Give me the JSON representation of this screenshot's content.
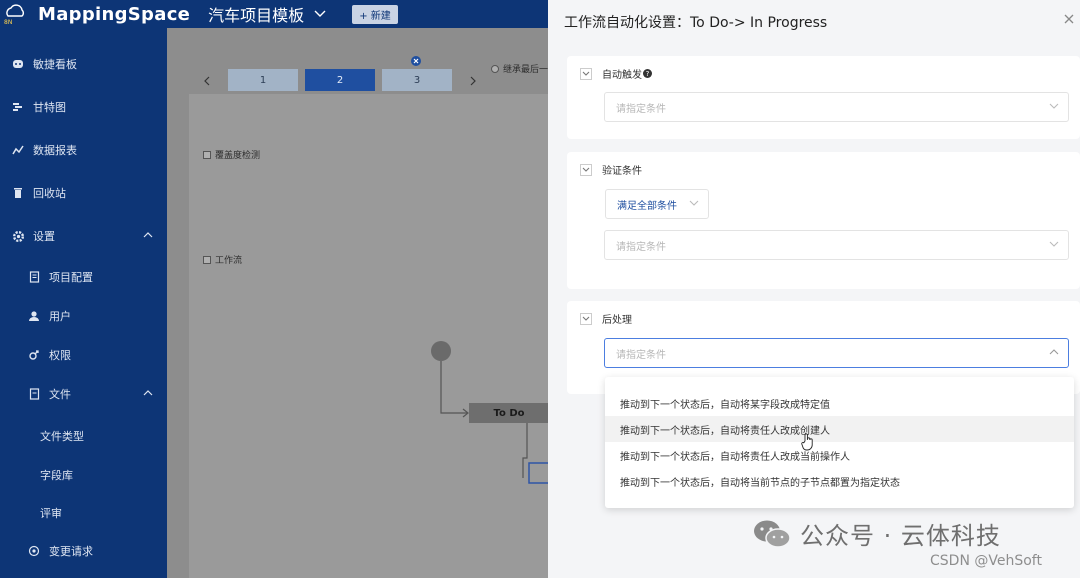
{
  "header": {
    "logo_text": "MappingSpace",
    "logo_badge": "8N",
    "project_title": "汽车项目模板",
    "new_button": "+ 新建"
  },
  "sidebar": {
    "items": [
      {
        "label": "敏捷看板",
        "icon": "board-icon"
      },
      {
        "label": "甘特图",
        "icon": "gantt-icon"
      },
      {
        "label": "数据报表",
        "icon": "report-chart-icon"
      },
      {
        "label": "回收站",
        "icon": "trash-icon"
      },
      {
        "label": "设置",
        "icon": "gear-icon"
      },
      {
        "label": "项目配置",
        "icon": "document-icon"
      },
      {
        "label": "用户",
        "icon": "user-icon"
      },
      {
        "label": "权限",
        "icon": "permission-icon"
      },
      {
        "label": "文件",
        "icon": "file-icon"
      },
      {
        "label": "文件类型"
      },
      {
        "label": "字段库"
      },
      {
        "label": "评审"
      },
      {
        "label": "变更请求",
        "icon": "change-request-icon"
      }
    ]
  },
  "main": {
    "steps": [
      "1",
      "2",
      "3"
    ],
    "inherit_label": "继承最后一",
    "coverage_label": "覆盖度检测",
    "workflow_label": "工作流",
    "todo_node": "To Do"
  },
  "drawer": {
    "title": "工作流自动化设置：To Do-> In Progress",
    "auto_trigger": {
      "label": "自动触发",
      "placeholder": "请指定条件"
    },
    "validate": {
      "label": "验证条件",
      "match_select": "满足全部条件",
      "placeholder": "请指定条件"
    },
    "post": {
      "label": "后处理",
      "placeholder": "请指定条件"
    },
    "options": [
      "推动到下一个状态后，自动将某字段改成特定值",
      "推动到下一个状态后，自动将责任人改成创建人",
      "推动到下一个状态后，自动将责任人改成当前操作人",
      "推动到下一个状态后，自动将当前节点的子节点都置为指定状态"
    ]
  },
  "watermark": {
    "text": "公众号 · 云体科技",
    "csdn": "CSDN @VehSoft"
  },
  "colors": {
    "primary": "#0d3576",
    "accent": "#1f4fa0",
    "focus": "#4c7ee0"
  }
}
